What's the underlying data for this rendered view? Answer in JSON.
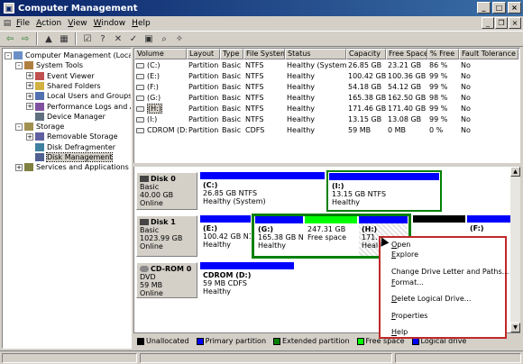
{
  "window": {
    "title": "Computer Management"
  },
  "menubar": {
    "items": [
      {
        "label": "File",
        "ul": "F",
        "rest": "ile"
      },
      {
        "label": "Action",
        "ul": "A",
        "rest": "ction"
      },
      {
        "label": "View",
        "ul": "V",
        "rest": "iew"
      },
      {
        "label": "Window",
        "ul": "W",
        "rest": "indow"
      },
      {
        "label": "Help",
        "ul": "H",
        "rest": "elp"
      }
    ]
  },
  "tree": [
    {
      "label": "Computer Management (Local)",
      "level": 0,
      "expander": "-"
    },
    {
      "label": "System Tools",
      "level": 1,
      "expander": "-"
    },
    {
      "label": "Event Viewer",
      "level": 2,
      "expander": "+"
    },
    {
      "label": "Shared Folders",
      "level": 2,
      "expander": "+"
    },
    {
      "label": "Local Users and Groups",
      "level": 2,
      "expander": "+"
    },
    {
      "label": "Performance Logs and Alerts",
      "level": 2,
      "expander": "+"
    },
    {
      "label": "Device Manager",
      "level": 2,
      "expander": ""
    },
    {
      "label": "Storage",
      "level": 1,
      "expander": "-"
    },
    {
      "label": "Removable Storage",
      "level": 2,
      "expander": "+"
    },
    {
      "label": "Disk Defragmenter",
      "level": 2,
      "expander": ""
    },
    {
      "label": "Disk Management",
      "level": 2,
      "expander": "",
      "selected": true
    },
    {
      "label": "Services and Applications",
      "level": 1,
      "expander": "+"
    }
  ],
  "volume_list": {
    "columns": [
      "Volume",
      "Layout",
      "Type",
      "File System",
      "Status",
      "Capacity",
      "Free Space",
      "% Free",
      "Fault Tolerance"
    ],
    "rows": [
      [
        "(C:)",
        "Partition",
        "Basic",
        "NTFS",
        "Healthy (System)",
        "26.85 GB",
        "23.21 GB",
        "86 %",
        "No"
      ],
      [
        "(E:)",
        "Partition",
        "Basic",
        "NTFS",
        "Healthy",
        "100.42 GB",
        "100.36 GB",
        "99 %",
        "No"
      ],
      [
        "(F:)",
        "Partition",
        "Basic",
        "NTFS",
        "Healthy",
        "54.18 GB",
        "54.12 GB",
        "99 %",
        "No"
      ],
      [
        "(G:)",
        "Partition",
        "Basic",
        "NTFS",
        "Healthy",
        "165.38 GB",
        "162.50 GB",
        "98 %",
        "No"
      ],
      [
        "(H:)",
        "Partition",
        "Basic",
        "NTFS",
        "Healthy",
        "171.46 GB",
        "171.40 GB",
        "99 %",
        "No"
      ],
      [
        "(I:)",
        "Partition",
        "Basic",
        "NTFS",
        "Healthy",
        "13.15 GB",
        "13.08 GB",
        "99 %",
        "No"
      ],
      [
        "CDROM (D:)",
        "Partition",
        "Basic",
        "CDFS",
        "Healthy",
        "59 MB",
        "0 MB",
        "0 %",
        "No"
      ]
    ]
  },
  "disks": {
    "disk0": {
      "name": "Disk 0",
      "type": "Basic",
      "size": "40.00 GB",
      "state": "Online",
      "parts": [
        {
          "name": "(C:)",
          "line1": "26.85 GB NTFS",
          "line2": "Healthy (System)"
        },
        {
          "name": "(I:)",
          "line1": "13.15 GB NTFS",
          "line2": "Healthy"
        }
      ]
    },
    "disk1": {
      "name": "Disk 1",
      "type": "Basic",
      "size": "1023.99 GB",
      "state": "Online",
      "parts": [
        {
          "name": "(E:)",
          "line1": "100.42 GB N1",
          "line2": "Healthy"
        },
        {
          "name": "(G:)",
          "line1": "165.38 GB N1",
          "line2": "Healthy"
        },
        {
          "name": "",
          "line1": "247.31 GB",
          "line2": "Free space"
        },
        {
          "name": "(H:)",
          "line1": "171.",
          "line2": "Heal"
        },
        {
          "name": "",
          "line1": "",
          "line2": ""
        },
        {
          "name": "(F:)",
          "line1": "",
          "line2": ""
        }
      ]
    },
    "cdrom0": {
      "name": "CD-ROM 0",
      "type": "DVD",
      "size": "59 MB",
      "state": "Online",
      "parts": [
        {
          "name": "CDROM (D:)",
          "line1": "59 MB CDFS",
          "line2": "Healthy"
        }
      ]
    }
  },
  "legend": [
    {
      "label": "Unallocated",
      "color": "#000000"
    },
    {
      "label": "Primary partition",
      "color": "#0000ff"
    },
    {
      "label": "Extended partition",
      "color": "#008000"
    },
    {
      "label": "Free space",
      "color": "#00ff00"
    },
    {
      "label": "Logical drive",
      "color": "#0000ff"
    }
  ],
  "context_menu": [
    {
      "label": "Open",
      "ul": "O",
      "rest": "pen"
    },
    {
      "label": "Explore",
      "ul": "E",
      "rest": "xplore"
    },
    {
      "label": "Change Drive Letter and Paths...",
      "ul": "",
      "rest": "Change Drive Letter and Paths..."
    },
    {
      "label": "Format...",
      "ul": "F",
      "rest": "ormat..."
    },
    {
      "label": "Delete Logical Drive...",
      "ul": "D",
      "rest": "elete Logical Drive..."
    },
    {
      "label": "Properties",
      "ul": "P",
      "rest": "roperties"
    },
    {
      "label": "Help",
      "ul": "H",
      "rest": "elp"
    }
  ],
  "colors": {
    "primary_bar": "#0000ff",
    "extended": "#008000",
    "free": "#00ff00",
    "unallocated": "#000000",
    "context_highlight": "#c0282a"
  }
}
